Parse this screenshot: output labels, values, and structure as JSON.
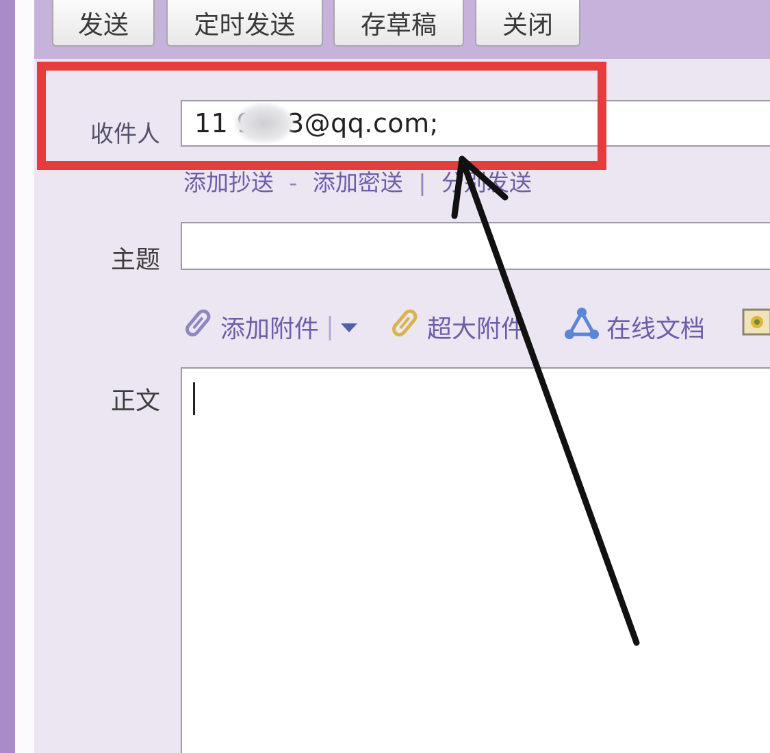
{
  "toolbar": {
    "send_label": "发送",
    "scheduled_send_label": "定时发送",
    "save_draft_label": "存草稿",
    "close_label": "关闭"
  },
  "recipient": {
    "label": "收件人",
    "value": "11⁠⁠ 9443@qq.com;"
  },
  "links": {
    "add_cc": "添加抄送",
    "dash": "-",
    "add_bcc": "添加密送",
    "divider": "|",
    "separate_send": "分别发送"
  },
  "subject": {
    "label": "主题",
    "value": ""
  },
  "attachments": {
    "add_attachment": "添加附件",
    "divider": "|",
    "large_attachment": "超大附件",
    "online_docs": "在线文档"
  },
  "body": {
    "label": "正文",
    "value": ""
  },
  "colors": {
    "toolbar_bg": "#c6b2db",
    "panel_bg": "#ece6f3",
    "link": "#6c5ea8",
    "highlight_red": "#e33d3d",
    "arrow": "#111111"
  },
  "icons": {
    "attach": "paperclip-icon",
    "large_attach": "gold-paperclip-icon",
    "online_doc": "triangle-nodes-icon",
    "image": "image-icon",
    "dropdown": "caret-down-icon"
  }
}
